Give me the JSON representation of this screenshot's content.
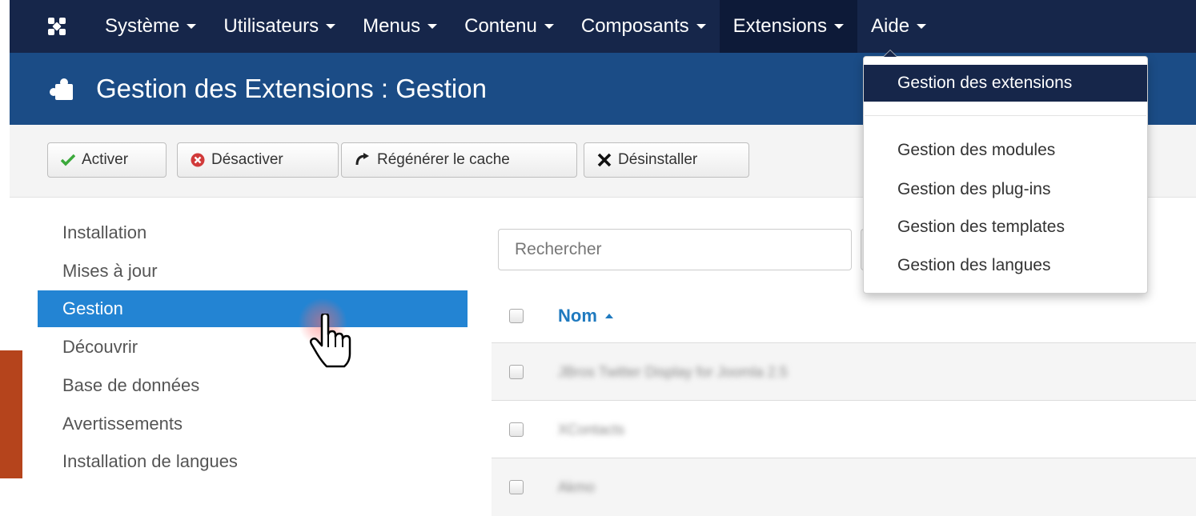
{
  "navbar": {
    "items": [
      {
        "label": "Système"
      },
      {
        "label": "Utilisateurs"
      },
      {
        "label": "Menus"
      },
      {
        "label": "Contenu"
      },
      {
        "label": "Composants"
      },
      {
        "label": "Extensions"
      },
      {
        "label": "Aide"
      }
    ],
    "active": "Extensions"
  },
  "header": {
    "title": "Gestion des Extensions : Gestion"
  },
  "toolbar": {
    "enable_label": "Activer",
    "disable_label": "Désactiver",
    "refresh_label": "Régénérer le cache",
    "uninstall_label": "Désinstaller"
  },
  "sidebar": {
    "items": [
      {
        "label": "Installation"
      },
      {
        "label": "Mises à jour"
      },
      {
        "label": "Gestion"
      },
      {
        "label": "Découvrir"
      },
      {
        "label": "Base de données"
      },
      {
        "label": "Avertissements"
      },
      {
        "label": "Installation de langues"
      }
    ],
    "active": "Gestion"
  },
  "search": {
    "placeholder": "Rechercher"
  },
  "table": {
    "column_name": "Nom",
    "rows": [
      {
        "name": "JBros Twitter Display for Joomla 2.5"
      },
      {
        "name": "XContacts"
      },
      {
        "name": "Akmo"
      }
    ]
  },
  "dropdown": {
    "items": [
      {
        "label": "Gestion des extensions"
      },
      {
        "label": "Gestion des modules"
      },
      {
        "label": "Gestion des plug-ins"
      },
      {
        "label": "Gestion des templates"
      },
      {
        "label": "Gestion des langues"
      }
    ],
    "active": "Gestion des extensions"
  },
  "colors": {
    "navbar": "#16264a",
    "header": "#1b4c86",
    "sidebar_active": "#2384d3",
    "link": "#1f7abf",
    "accent_decoration": "#b5441c"
  },
  "icons": {
    "logo": "joomla-logo-icon",
    "header": "puzzle-piece-icon",
    "enable": "check-icon",
    "disable": "circle-x-icon",
    "refresh": "refresh-icon",
    "uninstall": "x-icon",
    "cursor": "hand-pointer-icon"
  }
}
